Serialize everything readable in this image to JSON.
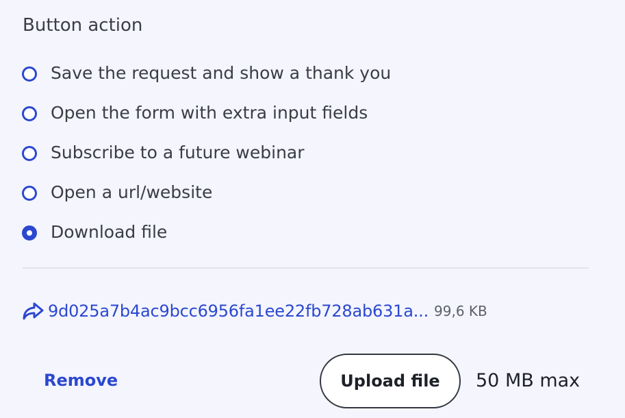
{
  "section": {
    "title": "Button action"
  },
  "radio_options": [
    {
      "label": "Save the request and show a thank you",
      "checked": false
    },
    {
      "label": "Open the form with extra input fields",
      "checked": false
    },
    {
      "label": "Subscribe to a future webinar",
      "checked": false
    },
    {
      "label": "Open a url/website",
      "checked": false
    },
    {
      "label": "Download file",
      "checked": true
    }
  ],
  "file": {
    "icon": "share-icon",
    "name": "9d025a7b4ac9bcc6956fa1ee22fb728ab631a...",
    "size": "99,6 KB"
  },
  "actions": {
    "remove_label": "Remove",
    "upload_label": "Upload file",
    "max_size": "50 MB max"
  },
  "colors": {
    "accent": "#2b48cf",
    "background": "#f4f5fd",
    "text": "#3a3d46"
  }
}
